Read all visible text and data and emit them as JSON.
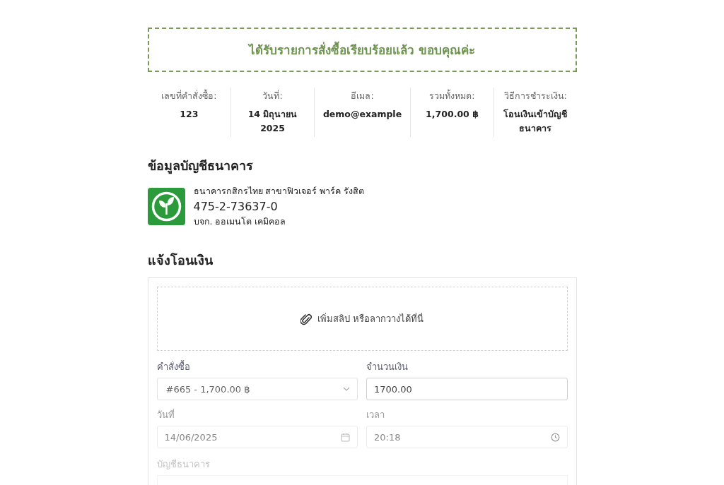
{
  "banner": {
    "message": "ได้รับรายการสั่งซื้อเรียบร้อยแล้ว ขอบคุณค่ะ"
  },
  "order_summary": [
    {
      "label": "เลขที่คำสั่งซื้อ:",
      "value": "123"
    },
    {
      "label": "วันที่:",
      "value": "14 มิถุนายน 2025"
    },
    {
      "label": "อีเมล:",
      "value": "demo@example"
    },
    {
      "label": "รวมทั้งหมด:",
      "value": "1,700.00 ฿"
    },
    {
      "label": "วิธีการชำระเงิน:",
      "value": "โอนเงินเข้าบัญชีธนาคาร"
    }
  ],
  "bank_section": {
    "heading": "ข้อมูลบัญชีธนาคาร",
    "bank_branch": "ธนาคารกสิกรไทย สาขาฟิวเจอร์ พาร์ค รังสิต",
    "account_number": "475-2-73637-0",
    "account_name": "บจก. ออเมนโต เคมิคอล"
  },
  "transfer_section": {
    "heading": "แจ้งโอนเงิน",
    "upload_hint": "เพิ่มสลิป หรือลากวางได้ที่นี่",
    "fields": [
      {
        "kind": "select",
        "label": "คำสั่งซื้อ",
        "value": "#665 - 1,700.00 ฿"
      },
      {
        "kind": "text",
        "label": "จำนวนเงิน",
        "value": "1700.00"
      },
      {
        "kind": "date",
        "label": "วันที่",
        "value": "14/06/2025"
      },
      {
        "kind": "time",
        "label": "เวลา",
        "value": "20:18"
      }
    ],
    "bank_account_label": "บัญชีธนาคาร"
  }
}
